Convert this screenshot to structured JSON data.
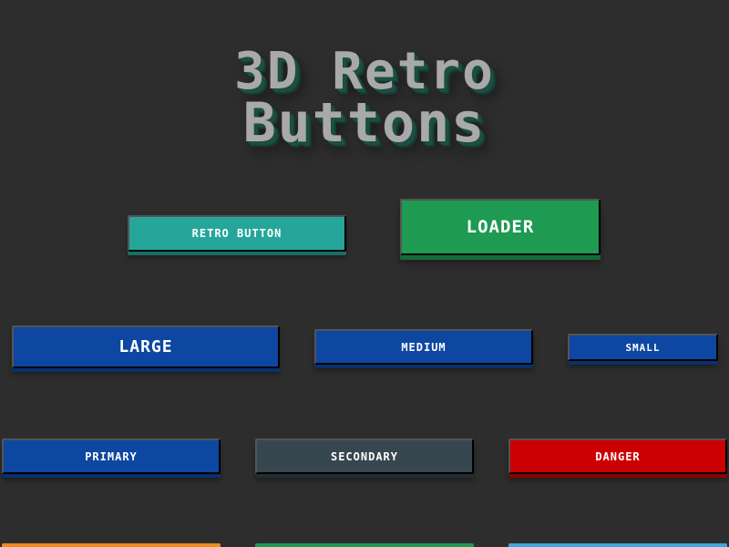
{
  "title": {
    "line1": "3D Retro",
    "line2": "Buttons"
  },
  "buttons": {
    "retro": {
      "label": "Retro Button",
      "color": "#26a69a"
    },
    "loader": {
      "label": "Loader",
      "color": "#1e9a52"
    },
    "large": {
      "label": "Large",
      "color": "#0d47a1"
    },
    "medium": {
      "label": "Medium",
      "color": "#0d47a1"
    },
    "small": {
      "label": "Small",
      "color": "#0d47a1"
    },
    "primary": {
      "label": "Primary",
      "color": "#0d47a1"
    },
    "secondary": {
      "label": "Secondary",
      "color": "#37474f"
    },
    "danger": {
      "label": "Danger",
      "color": "#cc0000"
    }
  },
  "partial_row_colors": {
    "left": "#ef8c1a",
    "center": "#1e9a52",
    "right": "#3fa7e0"
  },
  "theme": {
    "background": "#2d2d2d",
    "title_color": "#a9a9a9",
    "title_shadow": "#1c4f41"
  }
}
